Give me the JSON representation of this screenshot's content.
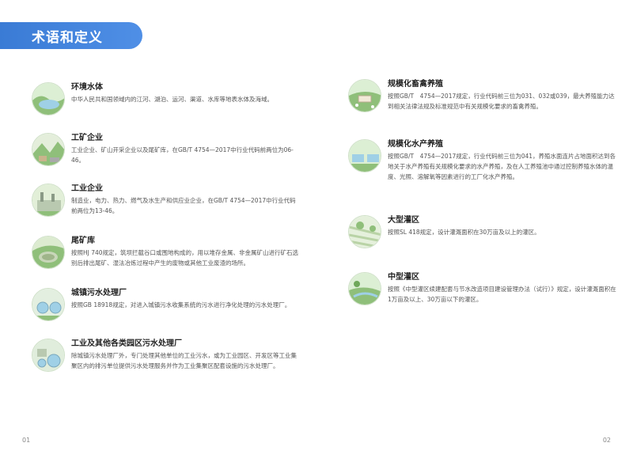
{
  "header": {
    "title": "术语和定义"
  },
  "left_entries": [
    {
      "term": "环境水体",
      "definition": "中华人民共和国领域内的江河、湖泊、运河、渠道、水库等地表水体及海域。",
      "icon": "lake-icon"
    },
    {
      "term": "工矿企业",
      "definition": "工业企业、矿山开采企业以及尾矿库，在GB/T 4754—2017中行业代码前两位为06-46。",
      "icon": "mine-icon"
    },
    {
      "term": "工业企业",
      "definition": "制造业，电力、热力、燃气及水生产和供应业企业，在GB/T 4754—2017中行业代码前两位为13-46。",
      "icon": "factory-icon"
    },
    {
      "term": "尾矿库",
      "definition": "按照HJ 740规定，筑坝拦截谷口或围地构成的，用以堆存金属、非金属矿山进行矿石选别后排出尾矿、湿法冶炼过程中产生的废物或其他工业废渣的场所。",
      "icon": "tailings-pond-icon"
    },
    {
      "term": "城镇污水处理厂",
      "definition": "按照GB 18918规定，对进入城镇污水收集系统的污水进行净化处理的污水处理厂。",
      "icon": "sewage-plant-icon"
    },
    {
      "term": "工业及其他各类园区污水处理厂",
      "definition": "除城镇污水处理厂外，专门处理其他单位的工业污水，或为工业园区、开发区等工业集聚区内的排污单位提供污水处理服务并作为工业集聚区配套设施的污水处理厂。",
      "icon": "industrial-sewage-plant-icon"
    }
  ],
  "right_entries": [
    {
      "term": "规模化畜禽养殖",
      "definition": "按照GB/T　4754—2017规定，行业代码前三位为031、032或039，最大养殖能力达到相关法律法规及标准规范中有关规模化要求的畜禽养殖。",
      "icon": "livestock-farm-icon"
    },
    {
      "term": "规模化水产养殖",
      "definition": "按照GB/T　4754—2017规定，行业代码前三位为041，养殖水面连片占地面积达到各地关于水产养殖有关规模化要求的水产养殖，及在人工养殖池中通过控制养殖水体的温度、光照、溶解氧等因素进行的工厂化水产养殖。",
      "icon": "aquaculture-icon"
    },
    {
      "term": "大型灌区",
      "definition": "按照SL 418规定，设计灌溉面积在30万亩及以上的灌区。",
      "icon": "large-irrigation-icon"
    },
    {
      "term": "中型灌区",
      "definition": "按照《中型灌区续建配套与节水改造项目建设管理办法（试行）》规定，设计灌溉面积在1万亩及以上、30万亩以下的灌区。",
      "icon": "medium-irrigation-icon"
    }
  ],
  "footer": {
    "page_left": "01",
    "page_right": "02"
  },
  "colors": {
    "accent": "#3a7bd5",
    "icon_green": "#8fbf7a",
    "icon_water": "#9fd0e6"
  }
}
